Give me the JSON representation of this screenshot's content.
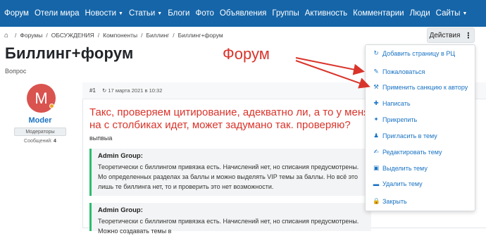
{
  "nav": {
    "items": [
      {
        "label": "Форум",
        "caret": false
      },
      {
        "label": "Отели мира",
        "caret": false
      },
      {
        "label": "Новости",
        "caret": true
      },
      {
        "label": "Статьи",
        "caret": true
      },
      {
        "label": "Блоги",
        "caret": false
      },
      {
        "label": "Фото",
        "caret": false
      },
      {
        "label": "Объявления",
        "caret": false
      },
      {
        "label": "Группы",
        "caret": false
      },
      {
        "label": "Активность",
        "caret": false
      },
      {
        "label": "Комментарии",
        "caret": false
      },
      {
        "label": "Люди",
        "caret": false
      },
      {
        "label": "Сайты",
        "caret": true
      }
    ],
    "caret_glyph": "▼"
  },
  "breadcrumb": {
    "home_icon": "⌂",
    "separator": "/",
    "items": [
      "Форумы",
      "ОБСУЖДЕНИЯ",
      "Компоненты",
      "Биллинг",
      "Биллинг+форум"
    ]
  },
  "actions": {
    "label": "Действия",
    "dots": "⋮"
  },
  "page": {
    "title": "Биллинг+форум",
    "subtitle": "Вопрос"
  },
  "annotation": {
    "label": "Форум",
    "color": "#d9342b"
  },
  "author": {
    "initial": "M",
    "name": "Moder",
    "role": "Модераторы",
    "messages_label": "Сообщений:",
    "messages_count": "4"
  },
  "post": {
    "number": "#1",
    "date_icon": "↻",
    "date": "17 марта 2021 в 10:32",
    "heading": "Такс, проверяем цитирование, адекватно ли, а то у меня на с столбиках идет, может задумано так. проверяю?",
    "text": "выпвыа",
    "quotes": [
      {
        "author": "Admin Group:",
        "body": "Теоретически с биллингом привязка есть. Начислений нет, но списания предусмотрены. Мо определенных разделах за баллы и можно выделять VIP темы за баллы. Но всё это лишь те биллинга нет, то и проверить это нет возможности."
      },
      {
        "author": "Admin Group:",
        "body": "Теоретически с биллингом привязка есть. Начислений нет, но списания предусмотрены. Можно создавать темы в"
      }
    ]
  },
  "dropdown": {
    "items": [
      {
        "icon": "↻",
        "label": "Добавить страницу в РЦ"
      },
      {
        "icon": "✎",
        "label": "Пожаловаться"
      },
      {
        "icon": "⚒",
        "label": "Применить санкцию к автору"
      },
      {
        "icon": "✚",
        "label": "Написать"
      },
      {
        "icon": "✦",
        "label": "Прикрепить"
      },
      {
        "icon": "♟",
        "label": "Пригласить в тему"
      },
      {
        "icon": "✍",
        "label": "Редактировать тему"
      },
      {
        "icon": "▣",
        "label": "Выделить тему"
      },
      {
        "icon": "▬",
        "label": "Удалить тему"
      },
      {
        "icon": "🔒",
        "label": "Закрыть"
      }
    ]
  },
  "colors": {
    "nav_bg": "#1565a8",
    "link": "#1a73c4",
    "heading_red": "#d9342b",
    "quote_border": "#2bbc6f",
    "avatar_bg": "#d9534f"
  }
}
